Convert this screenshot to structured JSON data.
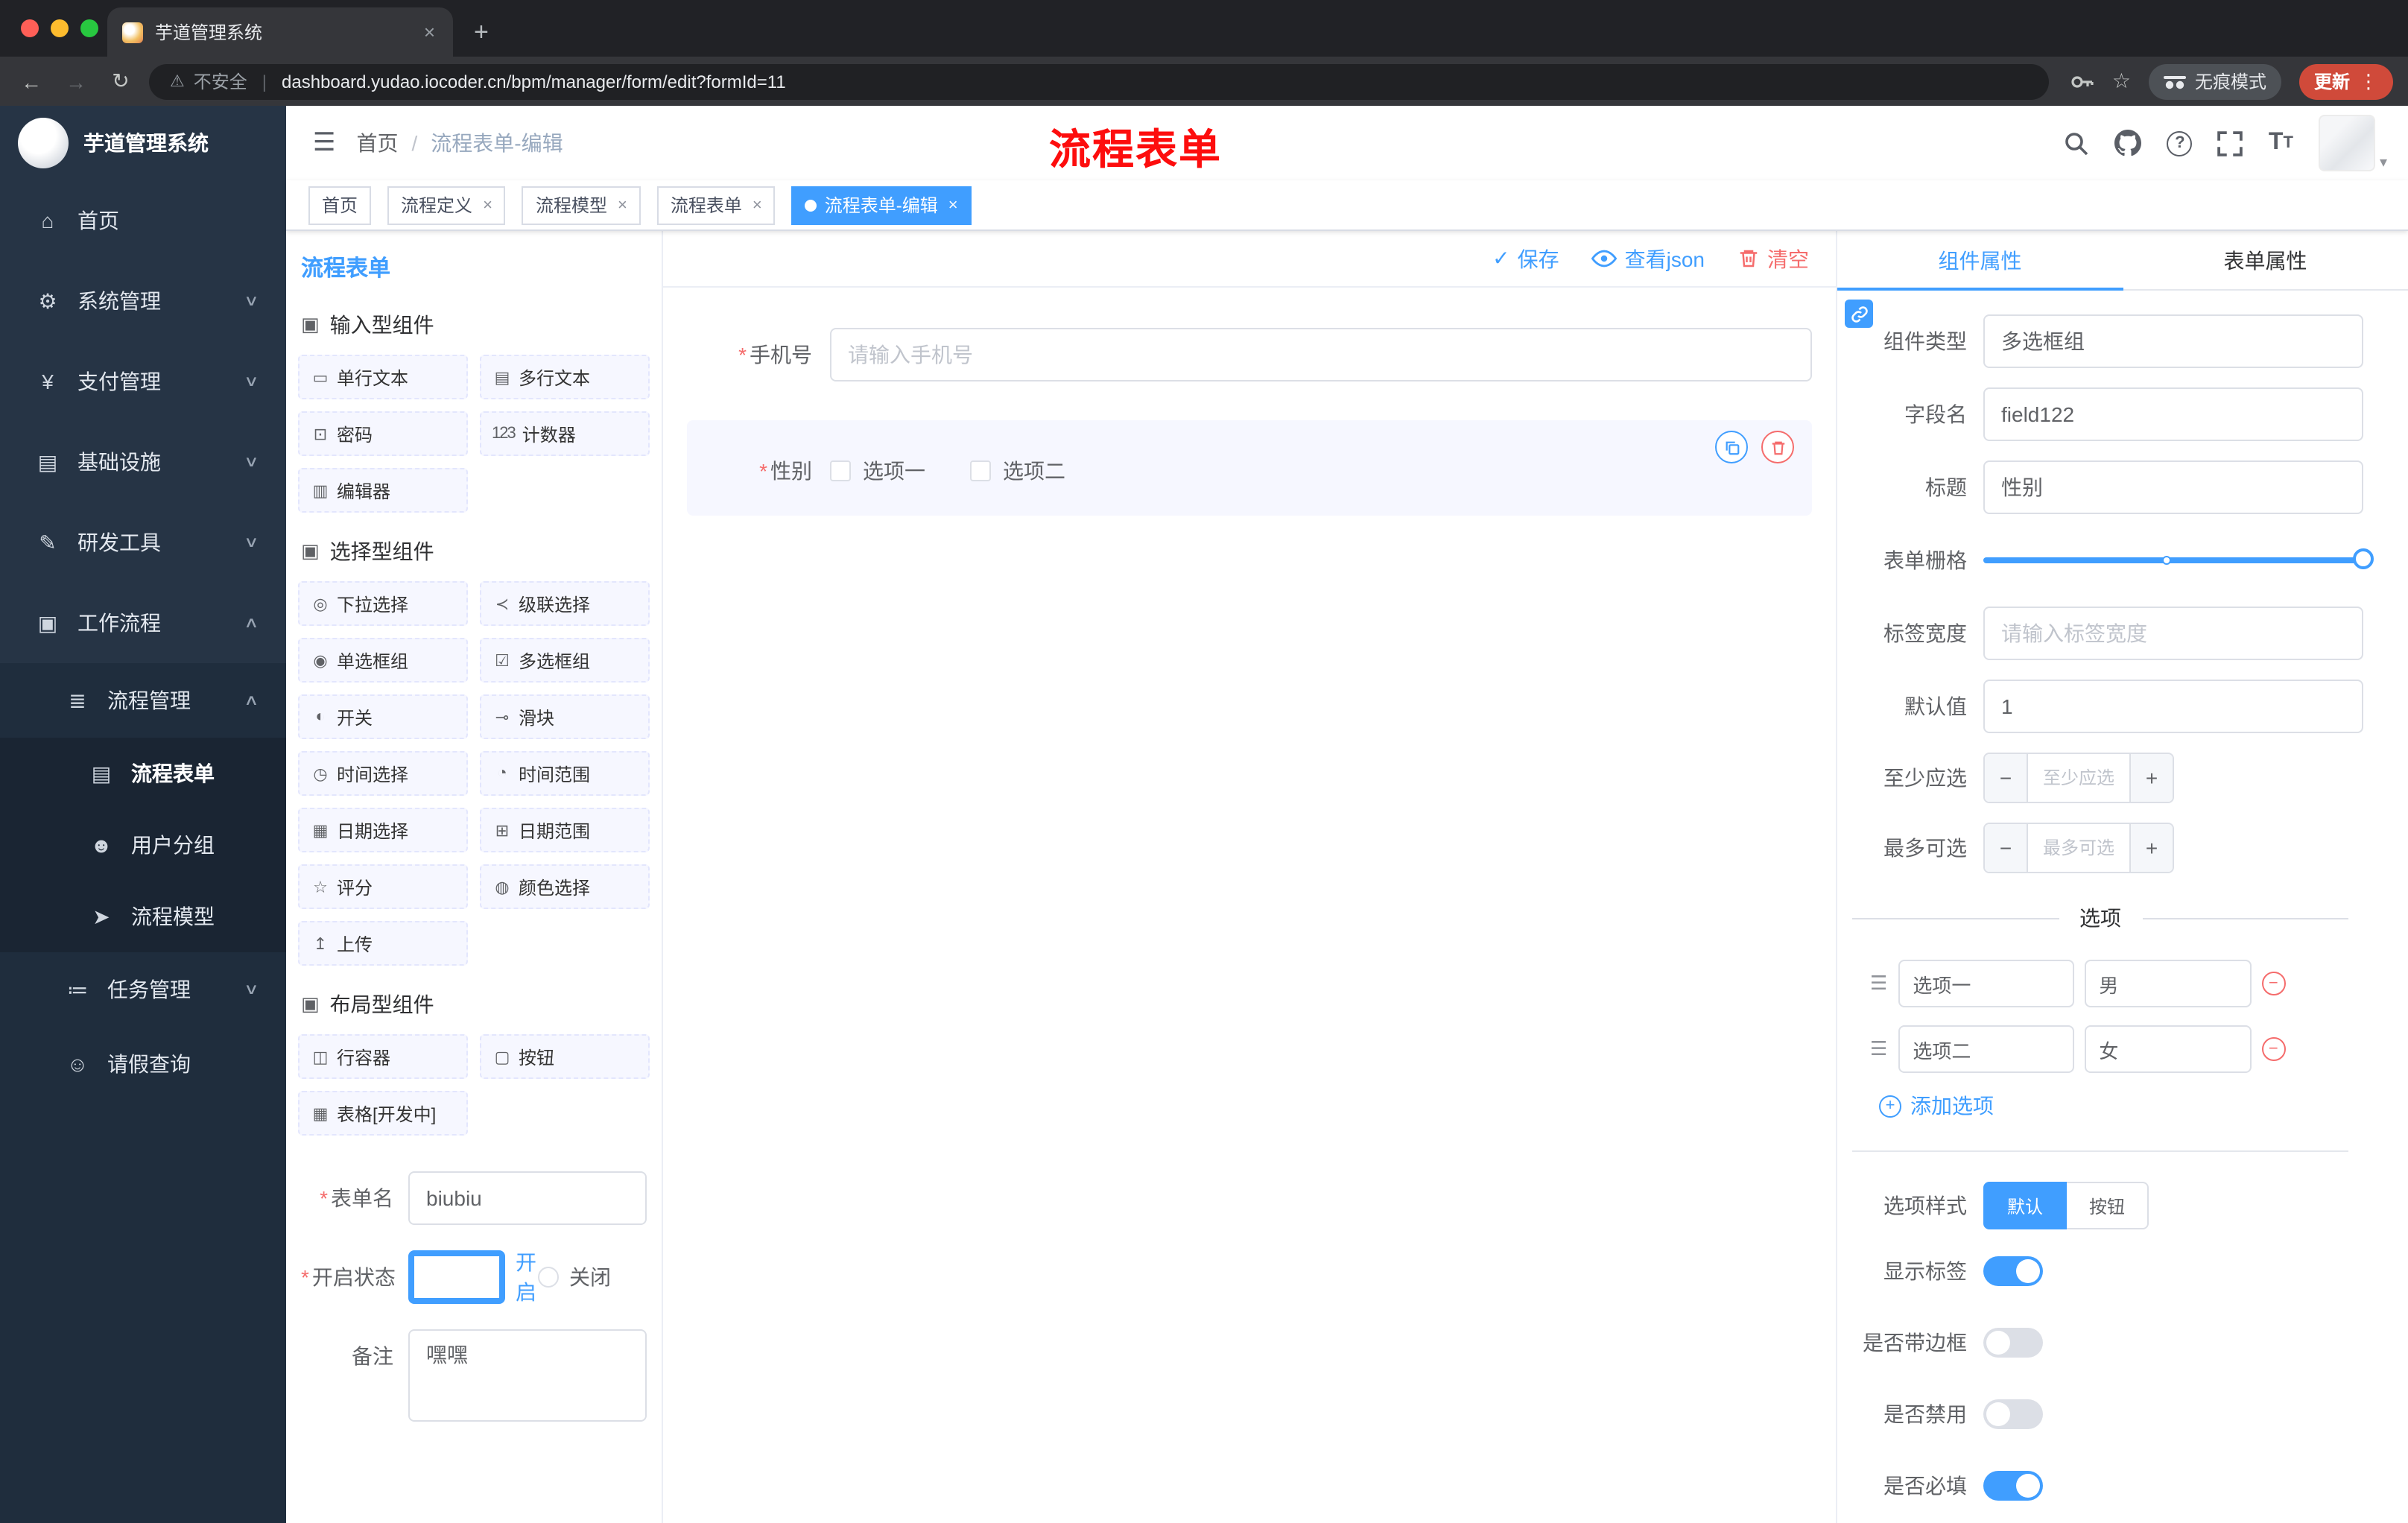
{
  "colors": {
    "accent": "#409EFF",
    "danger": "#F56C6C",
    "overlay_red": "#FD0D0D",
    "sidebar_bg": "#263445",
    "submenu_bg": "#1F2D3D"
  },
  "ui": {
    "glyphs": {
      "asterisk": "*",
      "hamburger": "☰",
      "chev_down": "∨",
      "chev_up": "∧",
      "close": "×",
      "dot_menu": "⋮",
      "caret_down": "▾",
      "warning": "⚠",
      "pipe": "|",
      "star": "☆",
      "question": "?",
      "font_big": "T",
      "font_small": "T",
      "check": "✓",
      "plus": "+",
      "minus": "−",
      "drag": "☰",
      "new_tab": "+",
      "back": "←",
      "forward": "→",
      "reload": "↻"
    }
  },
  "browser": {
    "tab": {
      "title": "芋道管理系统"
    },
    "address": {
      "security": "不安全",
      "url": "dashboard.yudao.iocoder.cn/bpm/manager/form/edit?formId=11"
    },
    "incognito_label": "无痕模式",
    "update_label": "更新"
  },
  "sidebar": {
    "logo_title": "芋道管理系统",
    "menu": [
      {
        "icon": "⌂",
        "label": "首页"
      },
      {
        "icon": "⚙",
        "label": "系统管理"
      },
      {
        "icon": "¥",
        "label": "支付管理"
      },
      {
        "icon": "▤",
        "label": "基础设施"
      },
      {
        "icon": "✎",
        "label": "研发工具"
      },
      {
        "icon": "▣",
        "label": "工作流程"
      }
    ],
    "submenu": {
      "process_mgmt": {
        "icon": "≣",
        "label": "流程管理"
      },
      "children": [
        {
          "icon": "▤",
          "label": "流程表单"
        },
        {
          "icon": "☻",
          "label": "用户分组"
        },
        {
          "icon": "➤",
          "label": "流程模型"
        }
      ],
      "task_mgmt": {
        "icon": "≔",
        "label": "任务管理"
      },
      "leave_query": {
        "icon": "☺",
        "label": "请假查询"
      }
    }
  },
  "header": {
    "breadcrumb": {
      "home": "首页",
      "sep": "/",
      "current": "流程表单-编辑"
    },
    "overlay_title": "流程表单"
  },
  "tags": [
    {
      "label": "首页"
    },
    {
      "label": "流程定义"
    },
    {
      "label": "流程模型"
    },
    {
      "label": "流程表单"
    },
    {
      "label": "流程表单-编辑"
    }
  ],
  "designer": {
    "title": "流程表单",
    "groups": [
      {
        "icon": "▣",
        "title": "输入型组件",
        "items": [
          {
            "icon": "▭",
            "label": "单行文本"
          },
          {
            "icon": "▤",
            "label": "多行文本"
          },
          {
            "icon": "⊡",
            "label": "密码"
          },
          {
            "icon": "123",
            "label": "计数器"
          },
          {
            "icon": "▥",
            "label": "编辑器"
          }
        ]
      },
      {
        "icon": "▣",
        "title": "选择型组件",
        "items": [
          {
            "icon": "◎",
            "label": "下拉选择"
          },
          {
            "icon": "≺",
            "label": "级联选择"
          },
          {
            "icon": "◉",
            "label": "单选框组"
          },
          {
            "icon": "☑",
            "label": "多选框组"
          },
          {
            "icon": "◐",
            "label": "开关"
          },
          {
            "icon": "⊸",
            "label": "滑块"
          },
          {
            "icon": "◷",
            "label": "时间选择"
          },
          {
            "icon": "◔",
            "label": "时间范围"
          },
          {
            "icon": "▦",
            "label": "日期选择"
          },
          {
            "icon": "⊞",
            "label": "日期范围"
          },
          {
            "icon": "☆",
            "label": "评分"
          },
          {
            "icon": "◍",
            "label": "颜色选择"
          },
          {
            "icon": "↥",
            "label": "上传"
          }
        ]
      },
      {
        "icon": "▣",
        "title": "布局型组件",
        "items": [
          {
            "icon": "◫",
            "label": "行容器"
          },
          {
            "icon": "▢",
            "label": "按钮"
          },
          {
            "icon": "▦",
            "label": "表格[开发中]"
          }
        ]
      }
    ],
    "form": {
      "name_label": "表单名",
      "name_value": "biubiu",
      "status_label": "开启状态",
      "status_on": "开启",
      "status_off": "关闭",
      "remark_label": "备注",
      "remark_value": "嘿嘿"
    }
  },
  "canvas": {
    "actions": {
      "save": "保存",
      "view_json": "查看json",
      "clear": "清空"
    },
    "phone": {
      "label": "手机号",
      "placeholder": "请输入手机号"
    },
    "gender": {
      "label": "性别",
      "options": [
        {
          "label": "选项一"
        },
        {
          "label": "选项二"
        }
      ]
    }
  },
  "props": {
    "tabs": {
      "component": "组件属性",
      "form": "表单属性"
    },
    "rows": {
      "type_label": "组件类型",
      "type_value": "多选框组",
      "field_label": "字段名",
      "field_value": "field122",
      "title_label": "标题",
      "title_value": "性别",
      "grid_label": "表单栅格",
      "width_label": "标签宽度",
      "width_placeholder": "请输入标签宽度",
      "default_label": "默认值",
      "default_value": "1",
      "min_label": "至少应选",
      "min_placeholder": "至少应选",
      "max_label": "最多可选",
      "max_placeholder": "最多可选"
    },
    "options": {
      "divider": "选项",
      "rows": [
        {
          "label": "选项一",
          "value": "男"
        },
        {
          "label": "选项二",
          "value": "女"
        }
      ],
      "add": "添加选项"
    },
    "style": {
      "label": "选项样式",
      "default": "默认",
      "button": "按钮"
    },
    "switches": [
      {
        "label": "显示标签",
        "on": true
      },
      {
        "label": "是否带边框",
        "on": false
      },
      {
        "label": "是否禁用",
        "on": false
      },
      {
        "label": "是否必填",
        "on": true
      }
    ]
  }
}
